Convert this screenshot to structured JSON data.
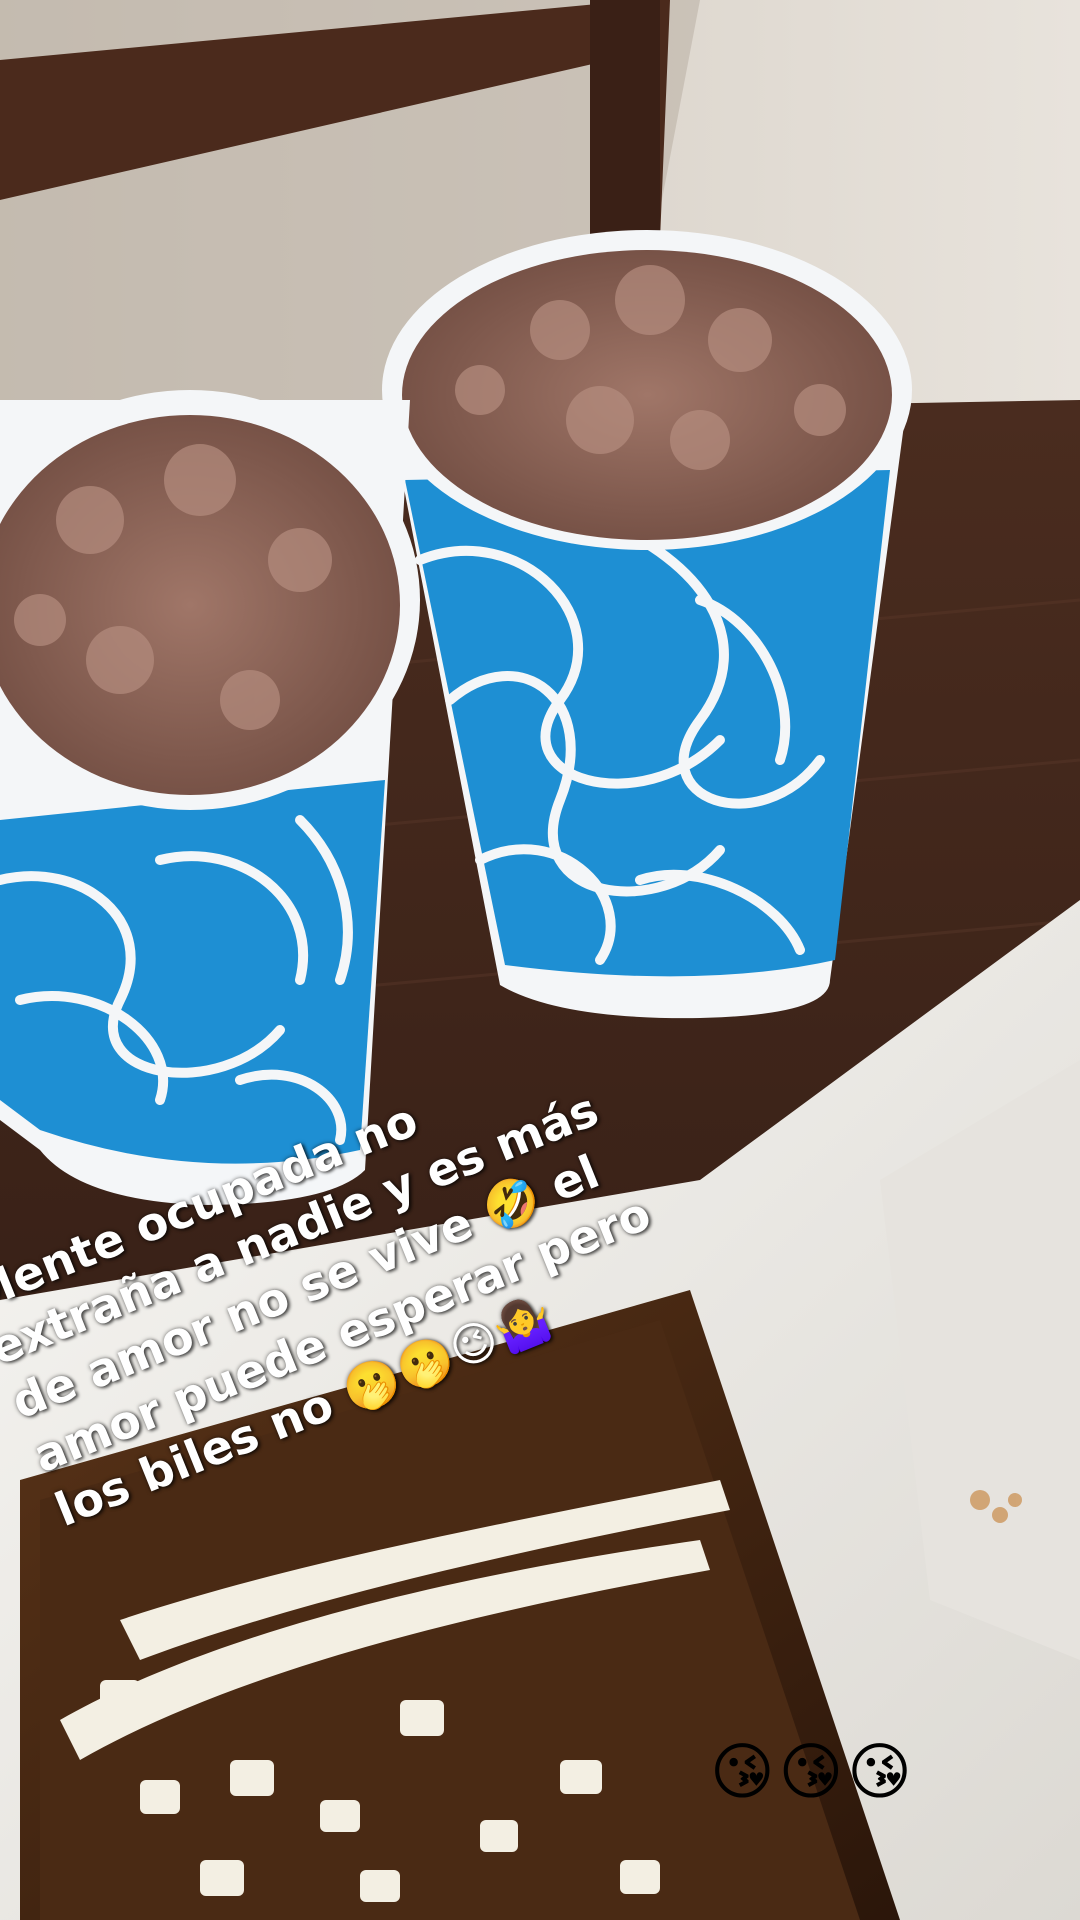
{
  "caption": {
    "line1": "Mente ocupada no",
    "line2": "extraña a nadie y es más",
    "line3": "de amor no se vive 🤣 el",
    "line4": "amor puede esperar pero",
    "line5": "los biles  no 🫢🫢😉🤷‍♀️"
  },
  "emoji_row": "😘😘😘",
  "colors": {
    "cup_blue": "#1e8fd3",
    "cup_white": "#f4f6f8",
    "chocolate_foam": "#8a5f52",
    "table_wood": "#3a2218",
    "tray_white": "#f2f0ec",
    "cheese": "#f3efe3",
    "sauce": "#3b1f10"
  }
}
